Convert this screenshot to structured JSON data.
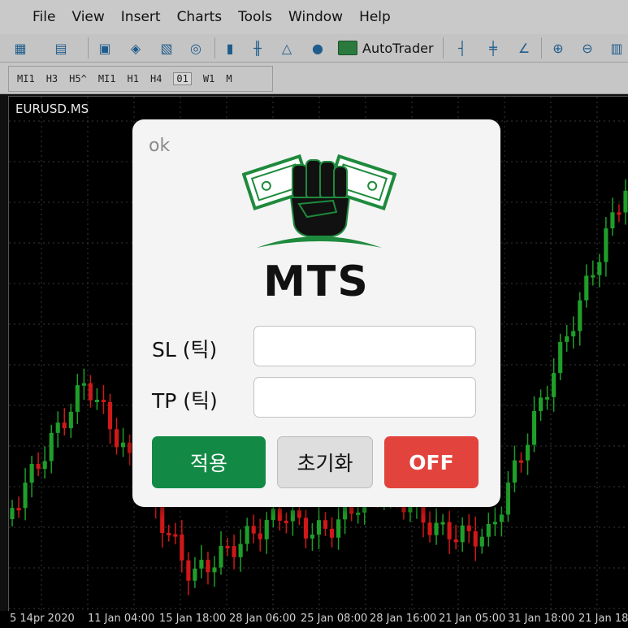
{
  "menu": [
    "File",
    "View",
    "Insert",
    "Charts",
    "Tools",
    "Window",
    "Help"
  ],
  "toolbar": {
    "autotrader_label": "AutoTrader",
    "icons": [
      "new-chart-icon",
      "profiles-icon",
      "market-watch-icon",
      "navigator-icon",
      "data-window-icon",
      "strategy-tester-icon",
      "new-order-icon",
      "depth-of-market-icon",
      "object-icon",
      "algo-icon",
      "bar-chart-icon",
      "candlestick-icon",
      "line-chart-icon",
      "zoom-in-icon",
      "zoom-out-icon"
    ]
  },
  "timeframes": [
    "MI1",
    "H3",
    "H5^",
    "MI1",
    "H1",
    "H4",
    "01",
    "W1",
    "M"
  ],
  "chart": {
    "symbol": "EURUSD.MS",
    "xaxis_labels": [
      "5 14pr 2020",
      "11 Jan 04:00",
      "15 Jan 18:00",
      "28 Jan 06:00",
      "25 Jan 08:00",
      "28 Jan 16:00",
      "21 Jan 05:00",
      "31 Jan 18:00",
      "21 Jan 18"
    ],
    "bull_color": "#1f9e2a",
    "bear_color": "#d01818",
    "grid_color": "#3a3a3a"
  },
  "dialog": {
    "ok_label": "ok",
    "brand": "MTS",
    "sl_label": "SL (틱)",
    "tp_label": "TP (틱)",
    "sl_value": "",
    "tp_value": "",
    "apply_label": "적용",
    "reset_label": "초기화",
    "off_label": "OFF",
    "apply_color": "#128a45",
    "off_color": "#e2443d"
  }
}
